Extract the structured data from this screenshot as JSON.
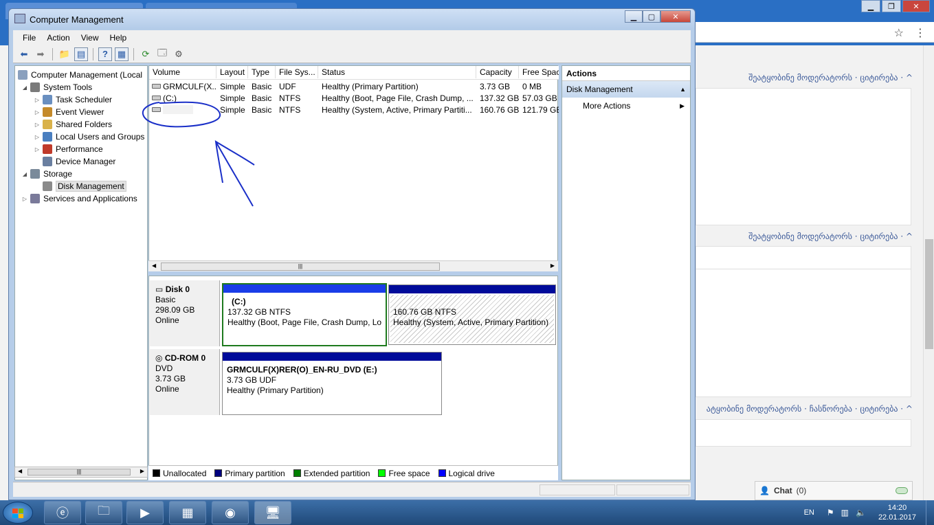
{
  "window": {
    "title": "Computer Management"
  },
  "browser": {
    "post_lines": [
      "შეატყობინე მოდერატორს · ციტირება · ^",
      "შეატყობინე მოდერატორს · ციტირება · ^",
      "ატყობინე მოდერატორს · ჩასწორება · ციტირება · ^"
    ],
    "chat_label": "Chat",
    "chat_count": "(0)"
  },
  "menu": [
    "File",
    "Action",
    "View",
    "Help"
  ],
  "tree": {
    "root": "Computer Management (Local",
    "items": [
      {
        "label": "System Tools",
        "level": 1,
        "expander": "◢",
        "icon_color": "#7a7a7a"
      },
      {
        "label": "Task Scheduler",
        "level": 2,
        "expander": "▷",
        "icon_color": "#6a8fc0"
      },
      {
        "label": "Event Viewer",
        "level": 2,
        "expander": "▷",
        "icon_color": "#c58a2a"
      },
      {
        "label": "Shared Folders",
        "level": 2,
        "expander": "▷",
        "icon_color": "#d9b24a"
      },
      {
        "label": "Local Users and Groups",
        "level": 2,
        "expander": "▷",
        "icon_color": "#4a7fc0"
      },
      {
        "label": "Performance",
        "level": 2,
        "expander": "▷",
        "icon_color": "#c03a2a"
      },
      {
        "label": "Device Manager",
        "level": 2,
        "expander": "",
        "icon_color": "#6a7fa0"
      },
      {
        "label": "Storage",
        "level": 1,
        "expander": "◢",
        "icon_color": "#7a8a9a"
      },
      {
        "label": "Disk Management",
        "level": 2,
        "expander": "",
        "icon_color": "#8a8a8a",
        "selected": true
      },
      {
        "label": "Services and Applications",
        "level": 1,
        "expander": "▷",
        "icon_color": "#7a7a9a"
      }
    ]
  },
  "volumes": {
    "columns": [
      "Volume",
      "Layout",
      "Type",
      "File Sys...",
      "Status",
      "Capacity",
      "Free Spac"
    ],
    "rows": [
      [
        "GRMCULF(X...",
        "Simple",
        "Basic",
        "UDF",
        "Healthy (Primary Partition)",
        "3.73 GB",
        "0 MB"
      ],
      [
        "(C:)",
        "Simple",
        "Basic",
        "NTFS",
        "Healthy (Boot, Page File, Crash Dump, ...",
        "137.32 GB",
        "57.03 GB"
      ],
      [
        "",
        "Simple",
        "Basic",
        "NTFS",
        "Healthy (System, Active, Primary Partiti...",
        "160.76 GB",
        "121.79 GB"
      ]
    ]
  },
  "disks": [
    {
      "name": "Disk 0",
      "type": "Basic",
      "size": "298.09 GB",
      "state": "Online",
      "partitions": [
        {
          "label": "(C:)",
          "size": "137.32 GB NTFS",
          "status": "Healthy (Boot, Page File, Crash Dump, Lo"
        },
        {
          "label": "",
          "size": "160.76 GB NTFS",
          "status": "Healthy (System, Active, Primary Partition)"
        }
      ]
    },
    {
      "name": "CD-ROM 0",
      "type": "DVD",
      "size": "3.73 GB",
      "state": "Online",
      "partitions": [
        {
          "label": "GRMCULF(X)RER(O)_EN-RU_DVD  (E:)",
          "size": "3.73 GB UDF",
          "status": "Healthy (Primary Partition)"
        }
      ]
    }
  ],
  "legend": [
    {
      "label": "Unallocated",
      "color": "#000000"
    },
    {
      "label": "Primary partition",
      "color": "#00007f"
    },
    {
      "label": "Extended partition",
      "color": "#007f00"
    },
    {
      "label": "Free space",
      "color": "#00ff00"
    },
    {
      "label": "Logical drive",
      "color": "#0000ff"
    }
  ],
  "actions": {
    "header": "Actions",
    "section": "Disk Management",
    "more": "More Actions"
  },
  "taskbar": {
    "lang": "EN",
    "time": "14:20",
    "date": "22.01.2017"
  }
}
